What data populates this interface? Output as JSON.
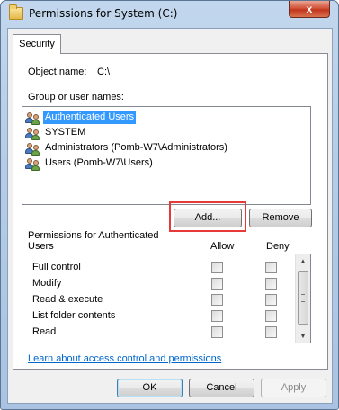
{
  "window": {
    "title": "Permissions for System (C:)",
    "close_glyph": "x"
  },
  "tab": {
    "label": "Security"
  },
  "object": {
    "label": "Object name:",
    "value": "C:\\"
  },
  "groups": {
    "label": "Group or user names:",
    "items": [
      {
        "name": "Authenticated Users",
        "selected": true,
        "icon": "users-icon"
      },
      {
        "name": "SYSTEM",
        "selected": false,
        "icon": "users-icon"
      },
      {
        "name": "Administrators (Pomb-W7\\Administrators)",
        "selected": false,
        "icon": "users-icon"
      },
      {
        "name": "Users (Pomb-W7\\Users)",
        "selected": false,
        "icon": "users-icon"
      }
    ]
  },
  "buttons": {
    "add": "Add...",
    "remove": "Remove",
    "ok": "OK",
    "cancel": "Cancel",
    "apply": "Apply"
  },
  "permissions": {
    "label_line1": "Permissions for Authenticated",
    "label_line2": "Users",
    "allow_header": "Allow",
    "deny_header": "Deny",
    "rows": [
      {
        "name": "Full control",
        "allow": false,
        "deny": false
      },
      {
        "name": "Modify",
        "allow": false,
        "deny": false
      },
      {
        "name": "Read & execute",
        "allow": false,
        "deny": false
      },
      {
        "name": "List folder contents",
        "allow": false,
        "deny": false
      },
      {
        "name": "Read",
        "allow": false,
        "deny": false
      }
    ]
  },
  "link": {
    "text": "Learn about access control and permissions"
  },
  "colors": {
    "selection": "#3399ff",
    "highlight_box": "#e6393a",
    "link": "#0066cc"
  }
}
